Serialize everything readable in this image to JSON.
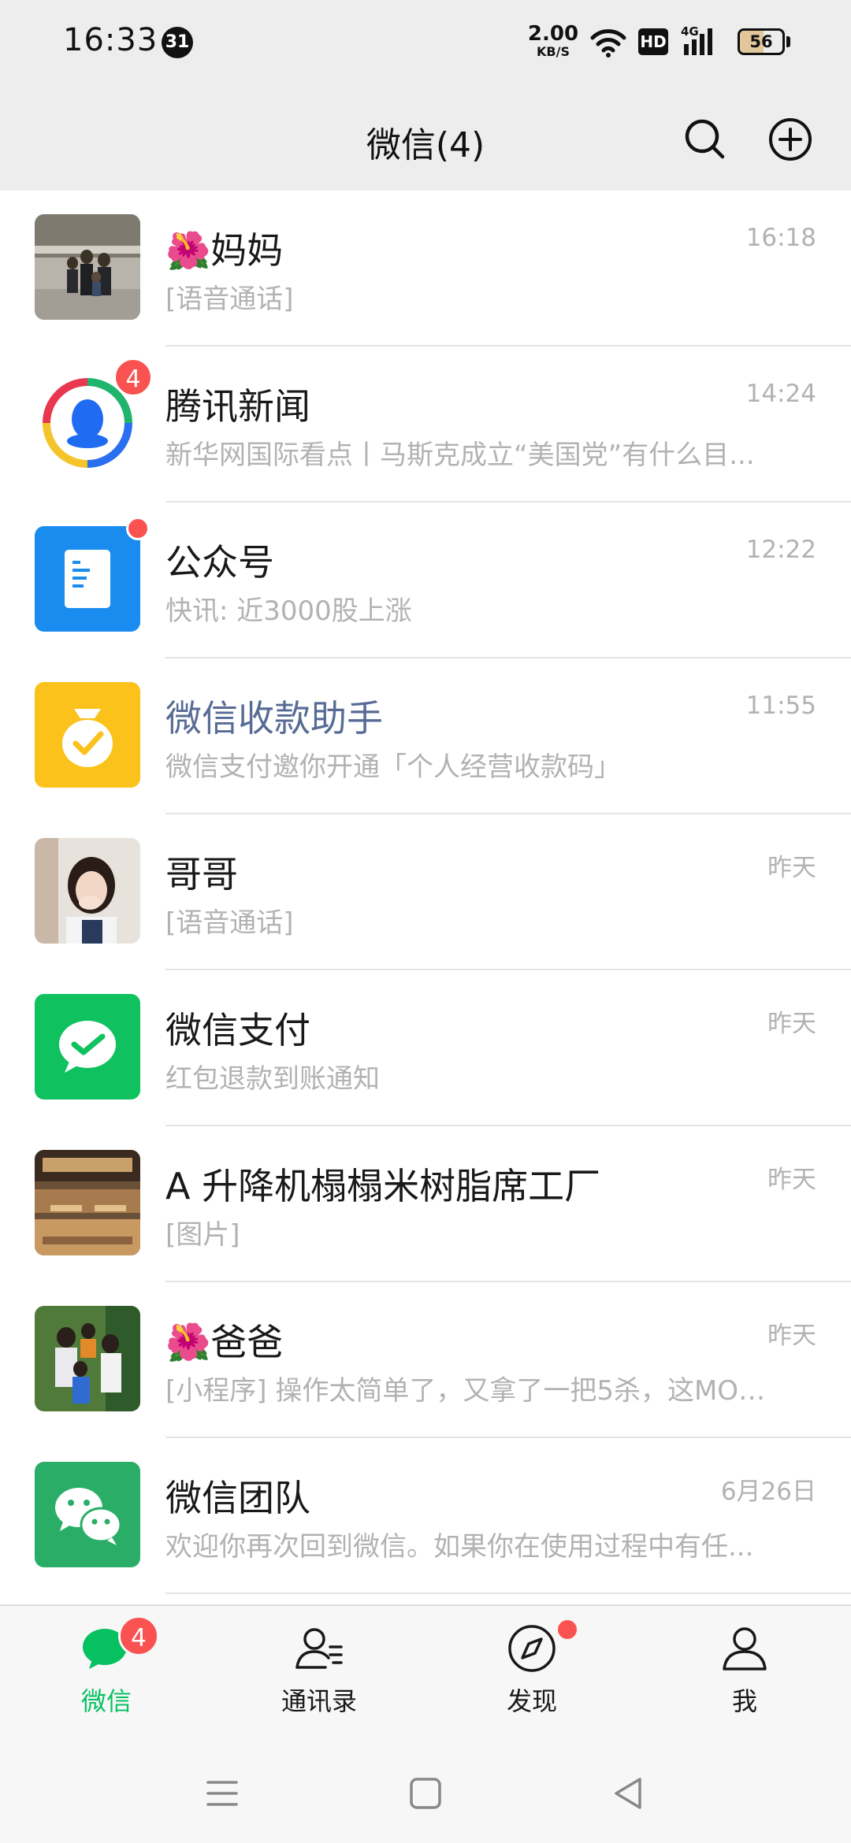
{
  "status": {
    "time": "16:33",
    "notification_count": "31",
    "net_speed_value": "2.00",
    "net_speed_unit": "KB/S",
    "hd": "HD",
    "network": "4G",
    "battery": "56",
    "battery_level": 0.56
  },
  "header": {
    "title": "微信(4)",
    "search_icon": "search-icon",
    "add_icon": "plus-circle-icon"
  },
  "chats": [
    {
      "name": "🌺妈妈",
      "preview": "[语音通话]",
      "time": "16:18"
    },
    {
      "name": "腾讯新闻",
      "preview": "新华网国际看点丨马斯克成立“美国党”有什么目...",
      "time": "14:24",
      "badge": "4"
    },
    {
      "name": "公众号",
      "preview": "快讯: 近3000股上涨",
      "time": "12:22"
    },
    {
      "name": "微信收款助手",
      "preview": "微信支付邀你开通「个人经营收款码」",
      "time": "11:55"
    },
    {
      "name": "哥哥",
      "preview": "[语音通话]",
      "time": "昨天"
    },
    {
      "name": "微信支付",
      "preview": "红包退款到账通知",
      "time": "昨天"
    },
    {
      "name": "A 升降机榻榻米树脂席工厂",
      "preview": "[图片]",
      "time": "昨天"
    },
    {
      "name": "🌺爸爸",
      "preview": "[小程序] 操作太简单了，又拿了一把5杀，这MOB...",
      "time": "昨天"
    },
    {
      "name": "微信团队",
      "preview": "欢迎你再次回到微信。如果你在使用过程中有任...",
      "time": "6月26日"
    }
  ],
  "tabs": [
    {
      "label": "微信",
      "icon": "chat-bubble-icon",
      "badge": "4"
    },
    {
      "label": "通讯录",
      "icon": "contacts-icon"
    },
    {
      "label": "发现",
      "icon": "compass-icon"
    },
    {
      "label": "我",
      "icon": "person-icon"
    }
  ],
  "colors": {
    "accent": "#07c160",
    "badge": "#fa5151",
    "link": "#576b95",
    "background": "#ededed"
  }
}
